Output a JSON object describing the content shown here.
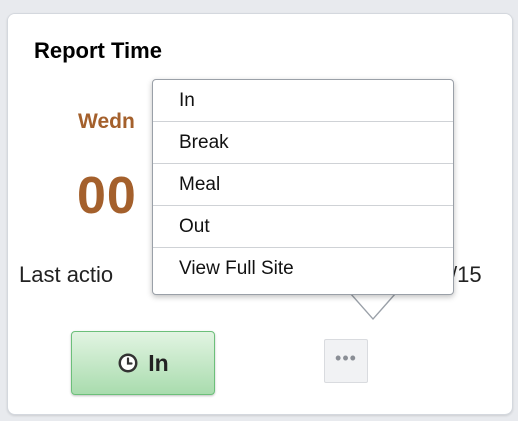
{
  "tile": {
    "title": "Report Time",
    "day_partial": "Wedn",
    "time_partial": "00",
    "last_action_partial": "Last actio",
    "last_date_partial": "/15"
  },
  "buttons": {
    "in_label": "In",
    "in_icon": "clock-icon",
    "more_label": "•••",
    "more_icon": "ellipsis-icon"
  },
  "popup_menu": {
    "items": [
      {
        "label": "In"
      },
      {
        "label": "Break"
      },
      {
        "label": "Meal"
      },
      {
        "label": "Out"
      },
      {
        "label": "View Full Site"
      }
    ]
  },
  "colors": {
    "accent_brown": "#a4602c",
    "button_green_light": "#e2f4e2",
    "button_green_dark": "#a9dcae"
  }
}
